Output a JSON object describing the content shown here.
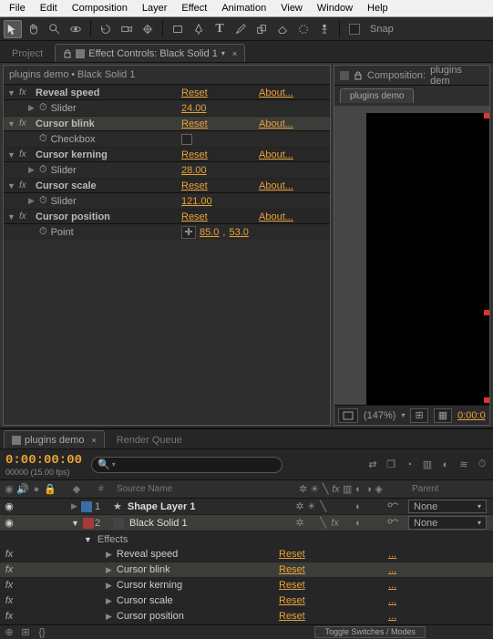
{
  "menu": {
    "file": "File",
    "edit": "Edit",
    "composition": "Composition",
    "layer": "Layer",
    "effect": "Effect",
    "animation": "Animation",
    "view": "View",
    "window": "Window",
    "help": "Help"
  },
  "toolbar": {
    "snap": "Snap"
  },
  "panel": {
    "project": "Project",
    "effectControls": "Effect Controls: Black Solid 1",
    "compositionPrefix": "Composition:",
    "compositionName": "plugins dem"
  },
  "crumb": {
    "comp": "plugins demo",
    "bullet": "•",
    "layer": "Black Solid 1"
  },
  "labels": {
    "reset": "Reset",
    "about": "About...",
    "slider": "Slider",
    "checkbox": "Checkbox",
    "point": "Point",
    "effects": "Effects",
    "sourceName": "Source Name",
    "parent": "Parent",
    "none": "None",
    "toggle": "Toggle Switches / Modes",
    "renderQueue": "Render Queue"
  },
  "effects": {
    "revealSpeed": {
      "name": "Reveal speed",
      "value": "24.00"
    },
    "cursorBlink": {
      "name": "Cursor blink"
    },
    "cursorKerning": {
      "name": "Cursor kerning",
      "value": "28.00"
    },
    "cursorScale": {
      "name": "Cursor scale",
      "value": "121.00"
    },
    "cursorPosition": {
      "name": "Cursor position",
      "px": "85.0",
      "py": "53.0"
    }
  },
  "compTab": "plugins demo",
  "compFooter": {
    "zoom": "(147%)",
    "time": "0:00:0"
  },
  "timeline": {
    "tab": "plugins demo",
    "tc": "0:00:00:00",
    "sub": "00000 (15.00 fps)",
    "search": ""
  },
  "layers": {
    "l1": {
      "num": "1",
      "name": "Shape Layer 1"
    },
    "l2": {
      "num": "2",
      "name": "Black Solid 1"
    }
  },
  "tlEffects": {
    "e1": "Reveal speed",
    "e2": "Cursor blink",
    "e3": "Cursor kerning",
    "e4": "Cursor scale",
    "e5": "Cursor position"
  },
  "dots": "..."
}
